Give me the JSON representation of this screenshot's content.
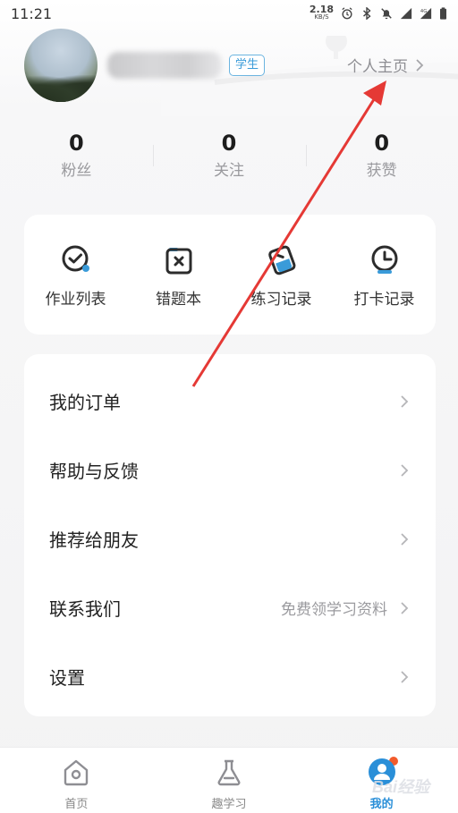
{
  "status_bar": {
    "time": "11:21",
    "net_speed_value": "2.18",
    "net_speed_unit": "KB/S",
    "icons": [
      "alarm-icon",
      "bluetooth-icon",
      "mute-icon",
      "signal-icon",
      "4g-signal-icon",
      "battery-icon"
    ]
  },
  "profile": {
    "username": "",
    "badge": "学生",
    "profile_link": "个人主页"
  },
  "stats": [
    {
      "value": "0",
      "label": "粉丝"
    },
    {
      "value": "0",
      "label": "关注"
    },
    {
      "value": "0",
      "label": "获赞"
    }
  ],
  "shortcuts": [
    {
      "label": "作业列表",
      "icon": "homework-list-icon"
    },
    {
      "label": "错题本",
      "icon": "wrong-question-book-icon"
    },
    {
      "label": "练习记录",
      "icon": "practice-record-icon"
    },
    {
      "label": "打卡记录",
      "icon": "checkin-clock-icon"
    }
  ],
  "menu": [
    {
      "label": "我的订单",
      "right_text": ""
    },
    {
      "label": "帮助与反馈",
      "right_text": ""
    },
    {
      "label": "推荐给朋友",
      "right_text": ""
    },
    {
      "label": "联系我们",
      "right_text": "免费领学习资料"
    },
    {
      "label": "设置",
      "right_text": ""
    }
  ],
  "tabs": [
    {
      "label": "首页",
      "icon": "home-icon",
      "active": false
    },
    {
      "label": "趣学习",
      "icon": "flask-icon",
      "active": false
    },
    {
      "label": "我的",
      "icon": "profile-icon",
      "active": true
    }
  ],
  "watermark": "Bai经验",
  "colors": {
    "accent": "#2a8fd8",
    "badge": "#3a9bd9",
    "notification_dot": "#f25b2c",
    "annotation_arrow": "#e53935"
  }
}
